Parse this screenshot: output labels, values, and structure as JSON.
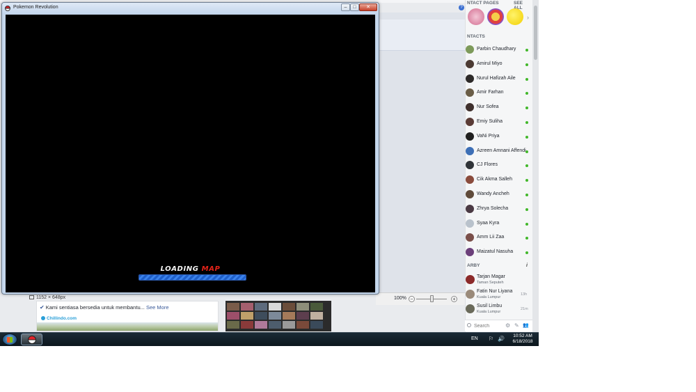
{
  "game_window": {
    "title": "Pokemon Revolution",
    "min_glyph": "–",
    "max_glyph": "□",
    "close_glyph": "✕",
    "loading_word": "LOADING",
    "loading_accent": "MAP",
    "progress": 1.0
  },
  "background": {
    "image_dims": "1152 × 648px",
    "zoom": "100%",
    "zoom_out": "−",
    "zoom_in": "+",
    "help_glyph": "?",
    "post_text": "Kami sentiasa bersedia untuk membantu...",
    "post_more": "See More",
    "post_brand": "Chillindo.com"
  },
  "sidebar": {
    "pages_header": "ntact pages",
    "see_all": "SEE ALL",
    "contacts_header": "ntacts",
    "contacts": [
      {
        "name": "Parbin Chaudhary",
        "color": "#7d9a5a"
      },
      {
        "name": "Amirul Miyo",
        "color": "#4b3a33"
      },
      {
        "name": "Nurul Hafizah Aile",
        "color": "#2d2a29"
      },
      {
        "name": "Amir Farhan",
        "color": "#6a5d47"
      },
      {
        "name": "Nur Sofea",
        "color": "#3e2f2c"
      },
      {
        "name": "Emiy Suliha",
        "color": "#5a3b36"
      },
      {
        "name": "VaNi Priya",
        "color": "#1f1f1f"
      },
      {
        "name": "Azreen Amnani Affendi",
        "color": "#3d6fb6"
      },
      {
        "name": "CJ Flores",
        "color": "#2f3338"
      },
      {
        "name": "Cik Akma Salleh",
        "color": "#8a4b3c"
      },
      {
        "name": "Wandy Ancheh",
        "color": "#5f4a3a"
      },
      {
        "name": "Zhrya Solecha",
        "color": "#4b3a44"
      },
      {
        "name": "Syaa Kyra",
        "color": "#b9c2cc"
      },
      {
        "name": "Amm Lii Zaa",
        "color": "#7a4f4a"
      },
      {
        "name": "Maizatul Nasuha",
        "color": "#6b3f7a"
      }
    ],
    "nearby_header": "arby",
    "nearby_info": "i",
    "nearby": [
      {
        "name": "Tarjan Magar",
        "location": "Taman Seputeh",
        "time": "",
        "color": "#8c2a2a"
      },
      {
        "name": "Fatin Nur Liyana",
        "location": "Kuala Lumpur",
        "time": "13h",
        "color": "#9a8a7a"
      },
      {
        "name": "Susil Limbu",
        "location": "Kuala Lumpur",
        "time": "21m",
        "color": "#6a6a5a"
      }
    ],
    "search_placeholder": "Search",
    "search_icons": [
      "⚙",
      "✎",
      "👥"
    ]
  },
  "taskbar": {
    "language": "EN",
    "tray": "⚐ 🔊",
    "time": "10:52 AM",
    "date": "6/18/2018"
  }
}
